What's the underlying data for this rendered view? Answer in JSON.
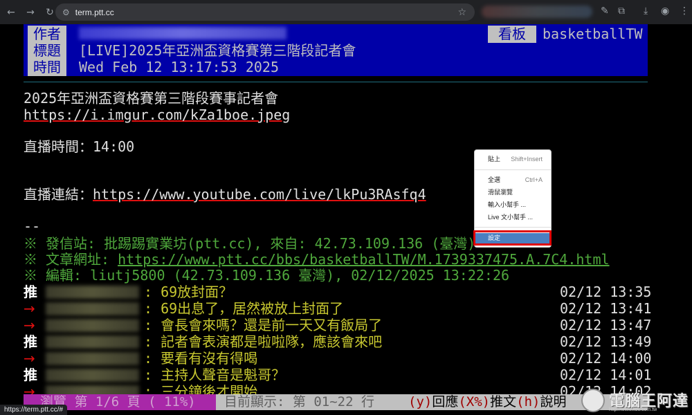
{
  "browser": {
    "url": "term.ptt.cc",
    "hover_url": "https://term.ptt.cc/#"
  },
  "header": {
    "author_label": "作者",
    "title_label": "標題",
    "time_label": "時間",
    "board_label": "看板",
    "board_value": "basketballTW",
    "title_value": "[LIVE]2025年亞洲盃資格賽第三階段記者會",
    "time_value": "Wed Feb 12 13:17:53 2025"
  },
  "body": {
    "line1": "2025年亞洲盃資格賽第三階段賽事記者會",
    "line2": "https://i.imgur.com/kZa1boe.jpeg",
    "live_time_label": "直播時間：",
    "live_time_value": "14:00",
    "live_link_label": "直播連結：",
    "live_link_value": "https://www.youtube.com/live/lkPu3RAsfq4",
    "signature_sep": "--",
    "source_line": "※ 發信站: 批踢踢實業坊(ptt.cc), 來自: 42.73.109.136 (臺灣)",
    "url_label": "※ 文章網址: ",
    "url_value": "https://www.ptt.cc/bbs/basketballTW/M.1739337475.A.7C4.html",
    "edit_line": "※ 編輯: liutj5800 (42.73.109.136 臺灣), 02/12/2025 13:22:26"
  },
  "pushes": [
    {
      "tag": "推",
      "type": "push",
      "text": ": 69放封面？",
      "time": "02/12 13:35"
    },
    {
      "tag": "→",
      "type": "arrow",
      "text": ": 69出息了，居然被放上封面了",
      "time": "02/12 13:41"
    },
    {
      "tag": "→",
      "type": "arrow",
      "text": ": 會長會來嗎？還是前一天又有飯局了",
      "time": "02/12 13:47"
    },
    {
      "tag": "推",
      "type": "push",
      "text": ": 記者會表演都是啦啦隊，應該會來吧",
      "time": "02/12 13:49"
    },
    {
      "tag": "→",
      "type": "arrow",
      "text": ": 要看有沒有得喝",
      "time": "02/12 14:00"
    },
    {
      "tag": "推",
      "type": "push",
      "text": ": 主持人聲音是魁哥？",
      "time": "02/12 14:01"
    },
    {
      "tag": "→",
      "type": "arrow",
      "text": ": 三分鐘後才開始",
      "time": "02/12 14:02"
    }
  ],
  "status_bar": {
    "left": "瀏覽 第 1/6 頁 ( 11%)",
    "mid": "目前顯示: 第 01~22 行",
    "k1": "(y)",
    "t1": "回應",
    "k2": "(X%)",
    "t2": "推文",
    "k3": "(h)",
    "t3": "說明"
  },
  "context_menu": {
    "paste": "貼上",
    "paste_shortcut": "Shift+Insert",
    "select_all": "全選",
    "select_all_shortcut": "Ctrl+A",
    "mouse_browse": "滑鼠瀏覽",
    "input_helper": "輸入小幫手 ...",
    "live_helper": "Live 文小幫手 ...",
    "settings": "設定"
  },
  "watermark": {
    "text": "電腦王阿達",
    "sub": "http://www.koc.com.tw"
  }
}
